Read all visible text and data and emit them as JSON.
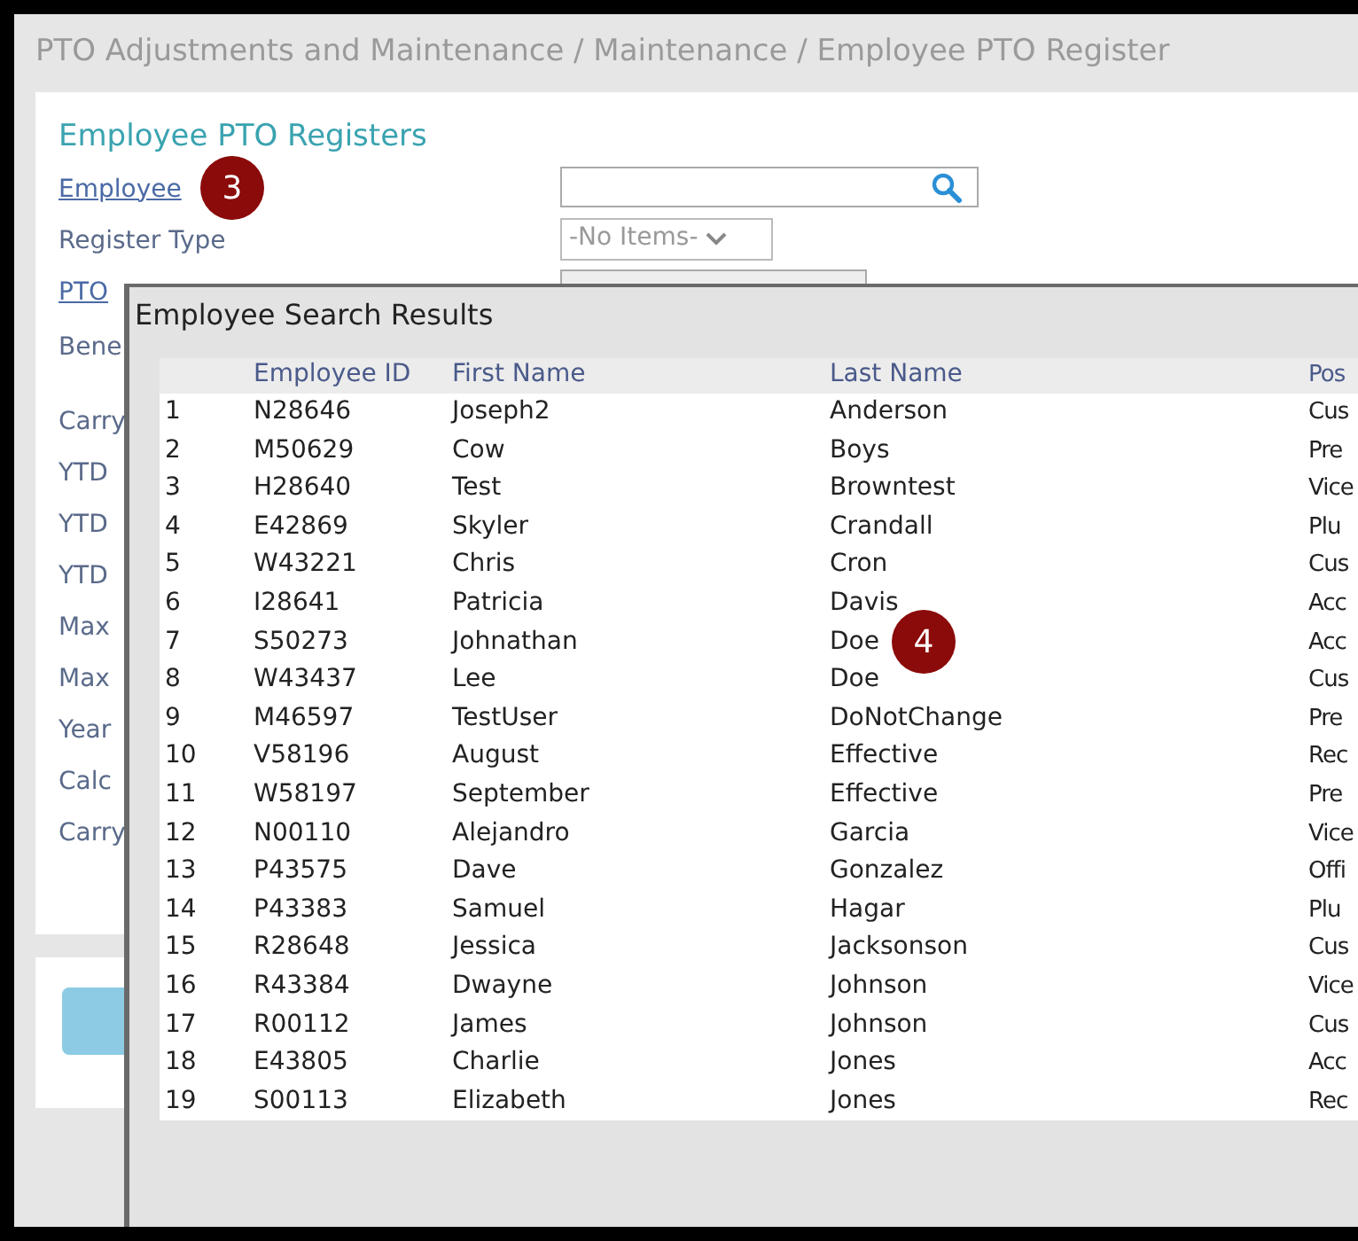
{
  "breadcrumb": "PTO Adjustments and Maintenance / Maintenance / Employee PTO Register",
  "form": {
    "title": "Employee PTO Registers",
    "fields": [
      {
        "label": "Employee",
        "kind": "search"
      },
      {
        "label": "Register Type",
        "kind": "select",
        "value": "-No Items-"
      },
      {
        "label": "PTO",
        "kind": "disabled"
      },
      {
        "label": "Bene",
        "kind": "none"
      },
      {
        "label": "Carry",
        "kind": "none"
      },
      {
        "label": "YTD",
        "kind": "none"
      },
      {
        "label": "YTD",
        "kind": "none"
      },
      {
        "label": "YTD",
        "kind": "none"
      },
      {
        "label": "Max",
        "kind": "none"
      },
      {
        "label": "Max",
        "kind": "none"
      },
      {
        "label": "Year",
        "kind": "none"
      },
      {
        "label": "Calc",
        "kind": "none"
      },
      {
        "label": "Carry",
        "kind": "none"
      }
    ]
  },
  "dialog": {
    "title": "Employee Search Results",
    "columns": [
      "",
      "Employee ID",
      "First Name",
      "Last Name",
      "Pos"
    ],
    "rows": [
      [
        "1",
        "N28646",
        "Joseph2",
        "Anderson",
        "Cus"
      ],
      [
        "2",
        "M50629",
        "Cow",
        "Boys",
        "Pre"
      ],
      [
        "3",
        "H28640",
        "Test",
        "Browntest",
        "Vice"
      ],
      [
        "4",
        "E42869",
        "Skyler",
        "Crandall",
        "Plu"
      ],
      [
        "5",
        "W43221",
        "Chris",
        "Cron",
        "Cus"
      ],
      [
        "6",
        "I28641",
        "Patricia",
        "Davis",
        "Acc"
      ],
      [
        "7",
        "S50273",
        "Johnathan",
        "Doe",
        "Acc"
      ],
      [
        "8",
        "W43437",
        "Lee",
        "Doe",
        "Cus"
      ],
      [
        "9",
        "M46597",
        "TestUser",
        "DoNotChange",
        "Pre"
      ],
      [
        "10",
        "V58196",
        "August",
        "Effective",
        "Rec"
      ],
      [
        "11",
        "W58197",
        "September",
        "Effective",
        "Pre"
      ],
      [
        "12",
        "N00110",
        "Alejandro",
        "Garcia",
        "Vice"
      ],
      [
        "13",
        "P43575",
        "Dave",
        "Gonzalez",
        "Offi"
      ],
      [
        "14",
        "P43383",
        "Samuel",
        "Hagar",
        "Plu"
      ],
      [
        "15",
        "R28648",
        "Jessica",
        "Jacksonson",
        "Cus"
      ],
      [
        "16",
        "R43384",
        "Dwayne",
        "Johnson",
        "Vice"
      ],
      [
        "17",
        "R00112",
        "James",
        "Johnson",
        "Cus"
      ],
      [
        "18",
        "E43805",
        "Charlie",
        "Jones",
        "Acc"
      ],
      [
        "19",
        "S00113",
        "Elizabeth",
        "Jones",
        "Rec"
      ]
    ]
  },
  "callouts": [
    {
      "text": "3"
    },
    {
      "text": "4"
    }
  ]
}
